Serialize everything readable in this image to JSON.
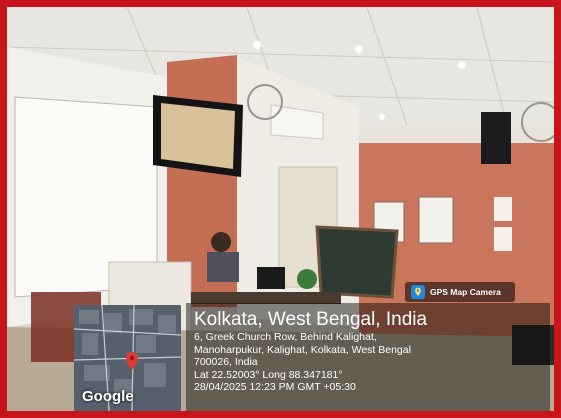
{
  "overlay": {
    "badge_label": "GPS Map Camera",
    "map_label": "Google",
    "location_title": "Kolkata, West Bengal, India",
    "address_lines": [
      "6, Greek Church Row, Behind Kalighat,",
      "Manoharpukur, Kalighat, Kolkata, West Bengal",
      "700026, India"
    ],
    "coordinates": "Lat 22.52003° Long 88.347181°",
    "timestamp": "28/04/2025 12:23 PM GMT +05:30"
  },
  "colors": {
    "frame_border": "#c8141b",
    "map_pin": "#e53935"
  },
  "icons": [
    "map-pin-icon",
    "gps-camera-icon"
  ]
}
